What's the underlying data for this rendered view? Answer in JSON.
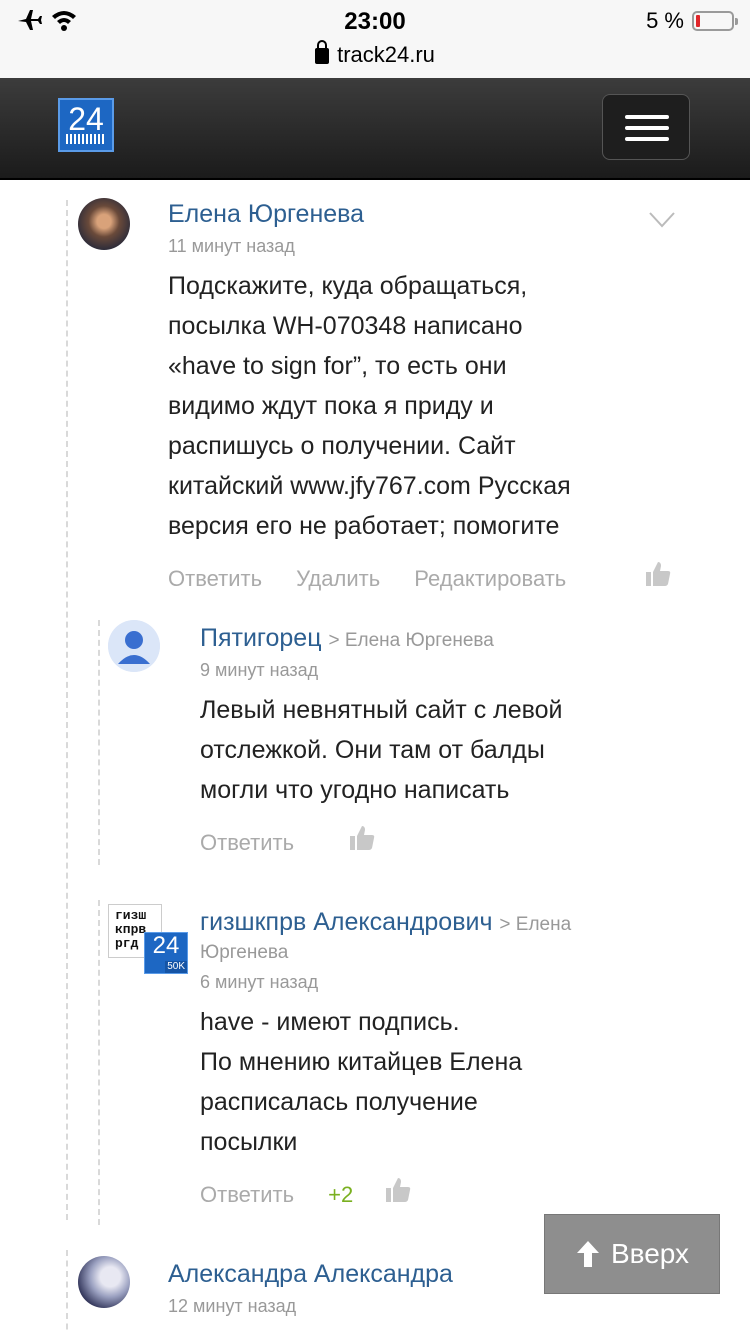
{
  "status": {
    "time": "23:00",
    "url": "track24.ru",
    "battery": "5 %",
    "left_icons": "✈ ᯤ"
  },
  "header": {
    "logo_text": "24"
  },
  "comments": [
    {
      "author": "Елена Юргенева",
      "time": "11 минут назад",
      "text": [
        "Подскажите, куда обращаться,",
        "посылка WH-070348 написано",
        "«have to sign for”, то есть они",
        "видимо ждут пока я приду и",
        "распишусь о получении. Сайт",
        "китайский www.jfy767.com Русская",
        "версия его не работает; помогите"
      ],
      "actions": {
        "reply": "Ответить",
        "delete": "Удалить",
        "edit": "Редактировать"
      }
    },
    {
      "author": "Пятигорец",
      "reply_to": "> Елена Юргенева",
      "time": "9 минут назад",
      "text": [
        "Левый невнятный сайт с левой",
        "отслежкой. Они там от балды",
        "могли что угодно написать"
      ],
      "actions": {
        "reply": "Ответить"
      }
    },
    {
      "author": "гизшкпрв Александрович",
      "reply_to_a": "> Елена",
      "reply_to_b": "Юргенева",
      "time": "6 минут назад",
      "text": [
        "have - имеют подпись.",
        "По мнению китайцев Елена",
        "расписалась получение",
        "посылки"
      ],
      "actions": {
        "reply": "Ответить"
      },
      "votes": "+2",
      "avatar_text": [
        "гизш",
        "кпрв",
        "ргд"
      ],
      "badge": {
        "number": "24",
        "label": "50K"
      }
    },
    {
      "author": "Александра Александра",
      "time": "12 минут назад"
    }
  ],
  "up_button": {
    "label": "Вверх"
  }
}
